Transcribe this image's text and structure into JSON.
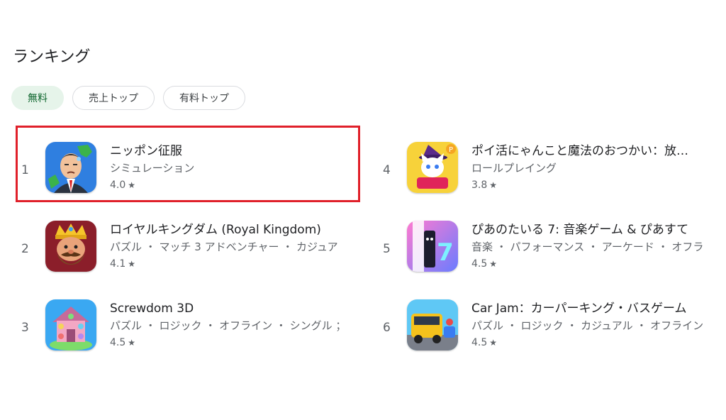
{
  "section": {
    "title": "ランキング"
  },
  "chips": [
    {
      "label": "無料",
      "selected": true
    },
    {
      "label": "売上トップ",
      "selected": false
    },
    {
      "label": "有料トップ",
      "selected": false
    }
  ],
  "apps": [
    {
      "rank": "1",
      "name": "ニッポン征服",
      "category": "シミュレーション",
      "rating": "4.0",
      "icon": "politician-icon"
    },
    {
      "rank": "2",
      "name": "ロイヤルキングダム (Royal Kingdom)",
      "category": "パズル ・ マッチ 3 アドベンチャー ・ カジュア",
      "rating": "4.1",
      "icon": "king-icon"
    },
    {
      "rank": "3",
      "name": "Screwdom 3D",
      "category": "パズル ・ ロジック ・ オフライン ・ シングル ；",
      "rating": "4.5",
      "icon": "screw-house-icon"
    },
    {
      "rank": "4",
      "name": "ポイ活にゃんこと魔法のおつかい：放…",
      "category": "ロールプレイング",
      "rating": "3.8",
      "icon": "witch-cat-icon"
    },
    {
      "rank": "5",
      "name": "ぴあのたいる 7: 音楽ゲーム & ぴあすて",
      "category": "音楽 ・ パフォーマンス ・ アーケード ・ オフラ",
      "rating": "4.5",
      "icon": "piano-tile-icon"
    },
    {
      "rank": "6",
      "name": "Car Jam：カーパーキング・バスゲーム",
      "category": "パズル ・ ロジック ・ カジュアル ・ オフライン",
      "rating": "4.5",
      "icon": "bus-icon"
    }
  ],
  "star_glyph": "★",
  "highlight_color": "#e0202a"
}
